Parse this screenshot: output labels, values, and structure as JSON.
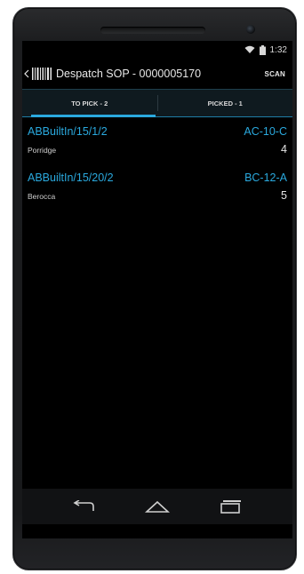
{
  "status_bar": {
    "time": "1:32",
    "icons": [
      "wifi-icon",
      "battery-icon"
    ]
  },
  "action_bar": {
    "title": "Despatch SOP - 0000005170",
    "scan_label": "SCAN",
    "icons": [
      "back-chevron-icon",
      "barcode-icon"
    ]
  },
  "tabs": [
    {
      "label": "TO PICK - 2",
      "selected": true
    },
    {
      "label": "PICKED - 1",
      "selected": false
    }
  ],
  "items": [
    {
      "code": "ABBuiltIn/15/1/2",
      "location": "AC-10-C",
      "name": "Porridge",
      "qty": "4"
    },
    {
      "code": "ABBuiltIn/15/20/2",
      "location": "BC-12-A",
      "name": "Berocca",
      "qty": "5"
    }
  ],
  "nav_bar": {
    "icons": [
      "back-icon",
      "home-icon",
      "recents-icon"
    ]
  },
  "colors": {
    "accent": "#2aa9de",
    "background": "#000000",
    "tab_background": "#0f1a1f"
  }
}
